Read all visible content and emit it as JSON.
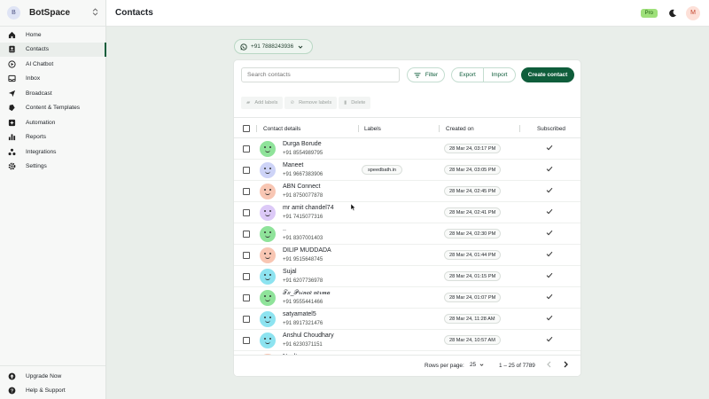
{
  "sidebar": {
    "brand_initial": "B",
    "brand_name": "BotSpace",
    "items": [
      {
        "label": "Home",
        "icon": "home-icon"
      },
      {
        "label": "Contacts",
        "icon": "contacts-icon",
        "active": true
      },
      {
        "label": "AI Chatbot",
        "icon": "chatbot-icon"
      },
      {
        "label": "Inbox",
        "icon": "inbox-icon"
      },
      {
        "label": "Broadcast",
        "icon": "broadcast-icon"
      },
      {
        "label": "Content & Templates",
        "icon": "templates-icon"
      },
      {
        "label": "Automation",
        "icon": "automation-icon"
      },
      {
        "label": "Reports",
        "icon": "reports-icon"
      },
      {
        "label": "Integrations",
        "icon": "integrations-icon"
      },
      {
        "label": "Settings",
        "icon": "settings-icon"
      }
    ],
    "bottom": [
      {
        "label": "Upgrade Now",
        "icon": "upgrade-icon"
      },
      {
        "label": "Help & Support",
        "icon": "help-icon"
      }
    ]
  },
  "header": {
    "title": "Contacts",
    "plan_badge": "Pro",
    "user_initial": "M"
  },
  "phone_selector": {
    "label": "+91 7888243936"
  },
  "toolbar": {
    "search_placeholder": "Search contacts",
    "filter_label": "Filter",
    "export_label": "Export",
    "import_label": "Import",
    "create_label": "Create contact"
  },
  "bulk_actions": {
    "add_label": "Add labels",
    "remove_label": "Remove labels",
    "delete_label": "Delete"
  },
  "table": {
    "headers": {
      "contact": "Contact details",
      "labels": "Labels",
      "created": "Created on",
      "subscribed": "Subscribed"
    },
    "rows": [
      {
        "name": "Durga Borude",
        "phone": "+91 8554989795",
        "label": "",
        "created": "28 Mar 24, 03:17 PM",
        "subscribed": true,
        "avatar_color": "#8fe39a"
      },
      {
        "name": "Maneet",
        "phone": "+91 9667383906",
        "label": "speedbath.in",
        "created": "28 Mar 24, 03:05 PM",
        "subscribed": true,
        "avatar_color": "#cdd3f7"
      },
      {
        "name": "ABN Connect",
        "phone": "+91 8750077878",
        "label": "",
        "created": "28 Mar 24, 02:45 PM",
        "subscribed": true,
        "avatar_color": "#f8c6b3"
      },
      {
        "name": "mr amit chandel74",
        "phone": "+91 7415077316",
        "label": "",
        "created": "28 Mar 24, 02:41 PM",
        "subscribed": true,
        "avatar_color": "#dcc9f7"
      },
      {
        "name": "..",
        "phone": "+91 8307001403",
        "label": "",
        "created": "28 Mar 24, 02:30 PM",
        "subscribed": true,
        "avatar_color": "#8fe39a"
      },
      {
        "name": "DILIP MUDDADA",
        "phone": "+91 9515648745",
        "label": "",
        "created": "28 Mar 24, 01:44 PM",
        "subscribed": true,
        "avatar_color": "#f8c6b3"
      },
      {
        "name": "Sujal",
        "phone": "+91 6207736978",
        "label": "",
        "created": "28 Mar 24, 01:15 PM",
        "subscribed": true,
        "avatar_color": "#8de3f0"
      },
      {
        "name": "𝒯𝓍_𝒫𝓇𝒾𝓃𝒸𝑒 𝓋𝑒𝓇𝓂𝒶",
        "phone": "+91 9555441466",
        "label": "",
        "created": "28 Mar 24, 01:07 PM",
        "subscribed": true,
        "avatar_color": "#8fe39a"
      },
      {
        "name": "satyamatel5",
        "phone": "+91 8917321476",
        "label": "",
        "created": "28 Mar 24, 11:28 AM",
        "subscribed": true,
        "avatar_color": "#8de3f0"
      },
      {
        "name": "Anshul Choudhary",
        "phone": "+91 6230371151",
        "label": "",
        "created": "28 Mar 24, 10:57 AM",
        "subscribed": true,
        "avatar_color": "#8de3f0"
      },
      {
        "name": "Naulta",
        "phone": "",
        "label": "",
        "created": "",
        "subscribed": false,
        "avatar_color": "#f8c6b3"
      }
    ]
  },
  "pagination": {
    "rows_per_page_label": "Rows per page:",
    "rows_per_page": "25",
    "range": "1 – 25 of 7789"
  },
  "colors": {
    "accent": "#0f5d3b",
    "pro_badge": "#9ee07a",
    "page_bg": "#e9eeea"
  }
}
